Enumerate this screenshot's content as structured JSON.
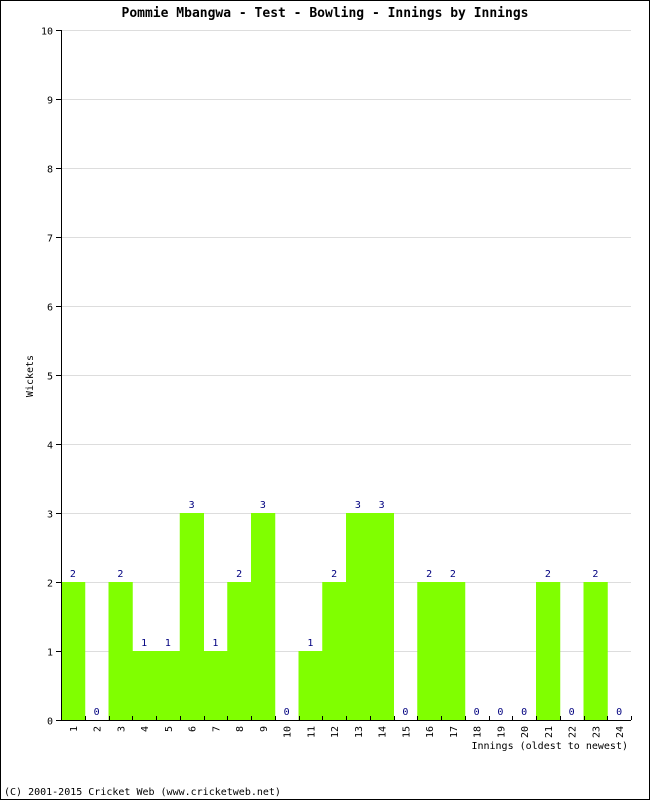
{
  "chart_data": {
    "type": "bar",
    "title": "Pommie Mbangwa - Test - Bowling - Innings by Innings",
    "xlabel": "Innings (oldest to newest)",
    "ylabel": "Wickets",
    "ylim": [
      0,
      10
    ],
    "yticks": [
      0,
      1,
      2,
      3,
      4,
      5,
      6,
      7,
      8,
      9,
      10
    ],
    "grid": true,
    "categories": [
      "1",
      "2",
      "3",
      "4",
      "5",
      "6",
      "7",
      "8",
      "9",
      "10",
      "11",
      "12",
      "13",
      "14",
      "15",
      "16",
      "17",
      "18",
      "19",
      "20",
      "21",
      "22",
      "23",
      "24"
    ],
    "values": [
      2,
      0,
      2,
      1,
      1,
      3,
      1,
      2,
      3,
      0,
      1,
      2,
      3,
      3,
      0,
      2,
      2,
      0,
      0,
      0,
      2,
      0,
      2,
      0
    ],
    "bar_color": "#80ff00",
    "label_color": "#000080",
    "grid_color": "#dddddd"
  },
  "footer": "(C) 2001-2015 Cricket Web (www.cricketweb.net)"
}
